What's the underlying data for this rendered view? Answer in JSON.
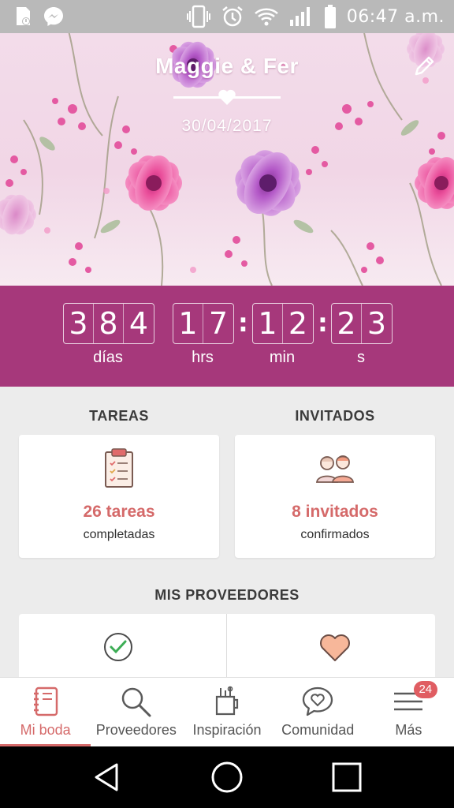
{
  "status_bar": {
    "time": "06:47 a.m.",
    "left_icons": [
      "sd-card-icon",
      "messenger-icon"
    ],
    "right_icons": [
      "vibrate-icon",
      "alarm-icon",
      "wifi-icon",
      "signal-icon",
      "battery-icon"
    ]
  },
  "header": {
    "couple_name": "Maggie & Fer",
    "wedding_date": "30/04/2017"
  },
  "countdown": {
    "days_digits": [
      "3",
      "8",
      "4"
    ],
    "hours_digits": [
      "1",
      "7"
    ],
    "minutes_digits": [
      "1",
      "2"
    ],
    "seconds_digits": [
      "2",
      "3"
    ],
    "separator": ":",
    "labels": {
      "days": "días",
      "hours": "hrs",
      "minutes": "min",
      "seconds": "s"
    }
  },
  "tasks": {
    "title": "TAREAS",
    "count": "26 tareas",
    "subtitle": "completadas"
  },
  "guests": {
    "title": "INVITADOS",
    "count": "8 invitados",
    "subtitle": "confirmados"
  },
  "providers": {
    "title": "MIS PROVEEDORES"
  },
  "bottom_nav": {
    "items": [
      {
        "label": "Mi boda",
        "icon": "notebook-icon",
        "active": true
      },
      {
        "label": "Proveedores",
        "icon": "search-icon"
      },
      {
        "label": "Inspiración",
        "icon": "inspiration-icon"
      },
      {
        "label": "Comunidad",
        "icon": "chat-heart-icon"
      },
      {
        "label": "Más",
        "icon": "menu-icon",
        "badge": "24"
      }
    ]
  },
  "colors": {
    "accent": "#a6387b",
    "highlight": "#d56a6a",
    "badge": "#e05d62"
  }
}
